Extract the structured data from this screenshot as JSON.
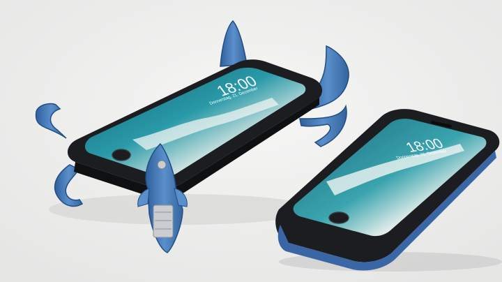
{
  "scene": {
    "description_free": true,
    "background_color": "#f1f1f0",
    "case_color": "#1c1d20",
    "bracket_color": "#4a7fbf",
    "bracket_highlight": "#7fb0e6",
    "metal_color": "#c9ccd0"
  },
  "phone_left": {
    "time": "18:00",
    "date": "Donnerstag, 21. Dezember"
  },
  "phone_right": {
    "time": "18:00",
    "date": "Donnerstag, 21. Dezember"
  }
}
